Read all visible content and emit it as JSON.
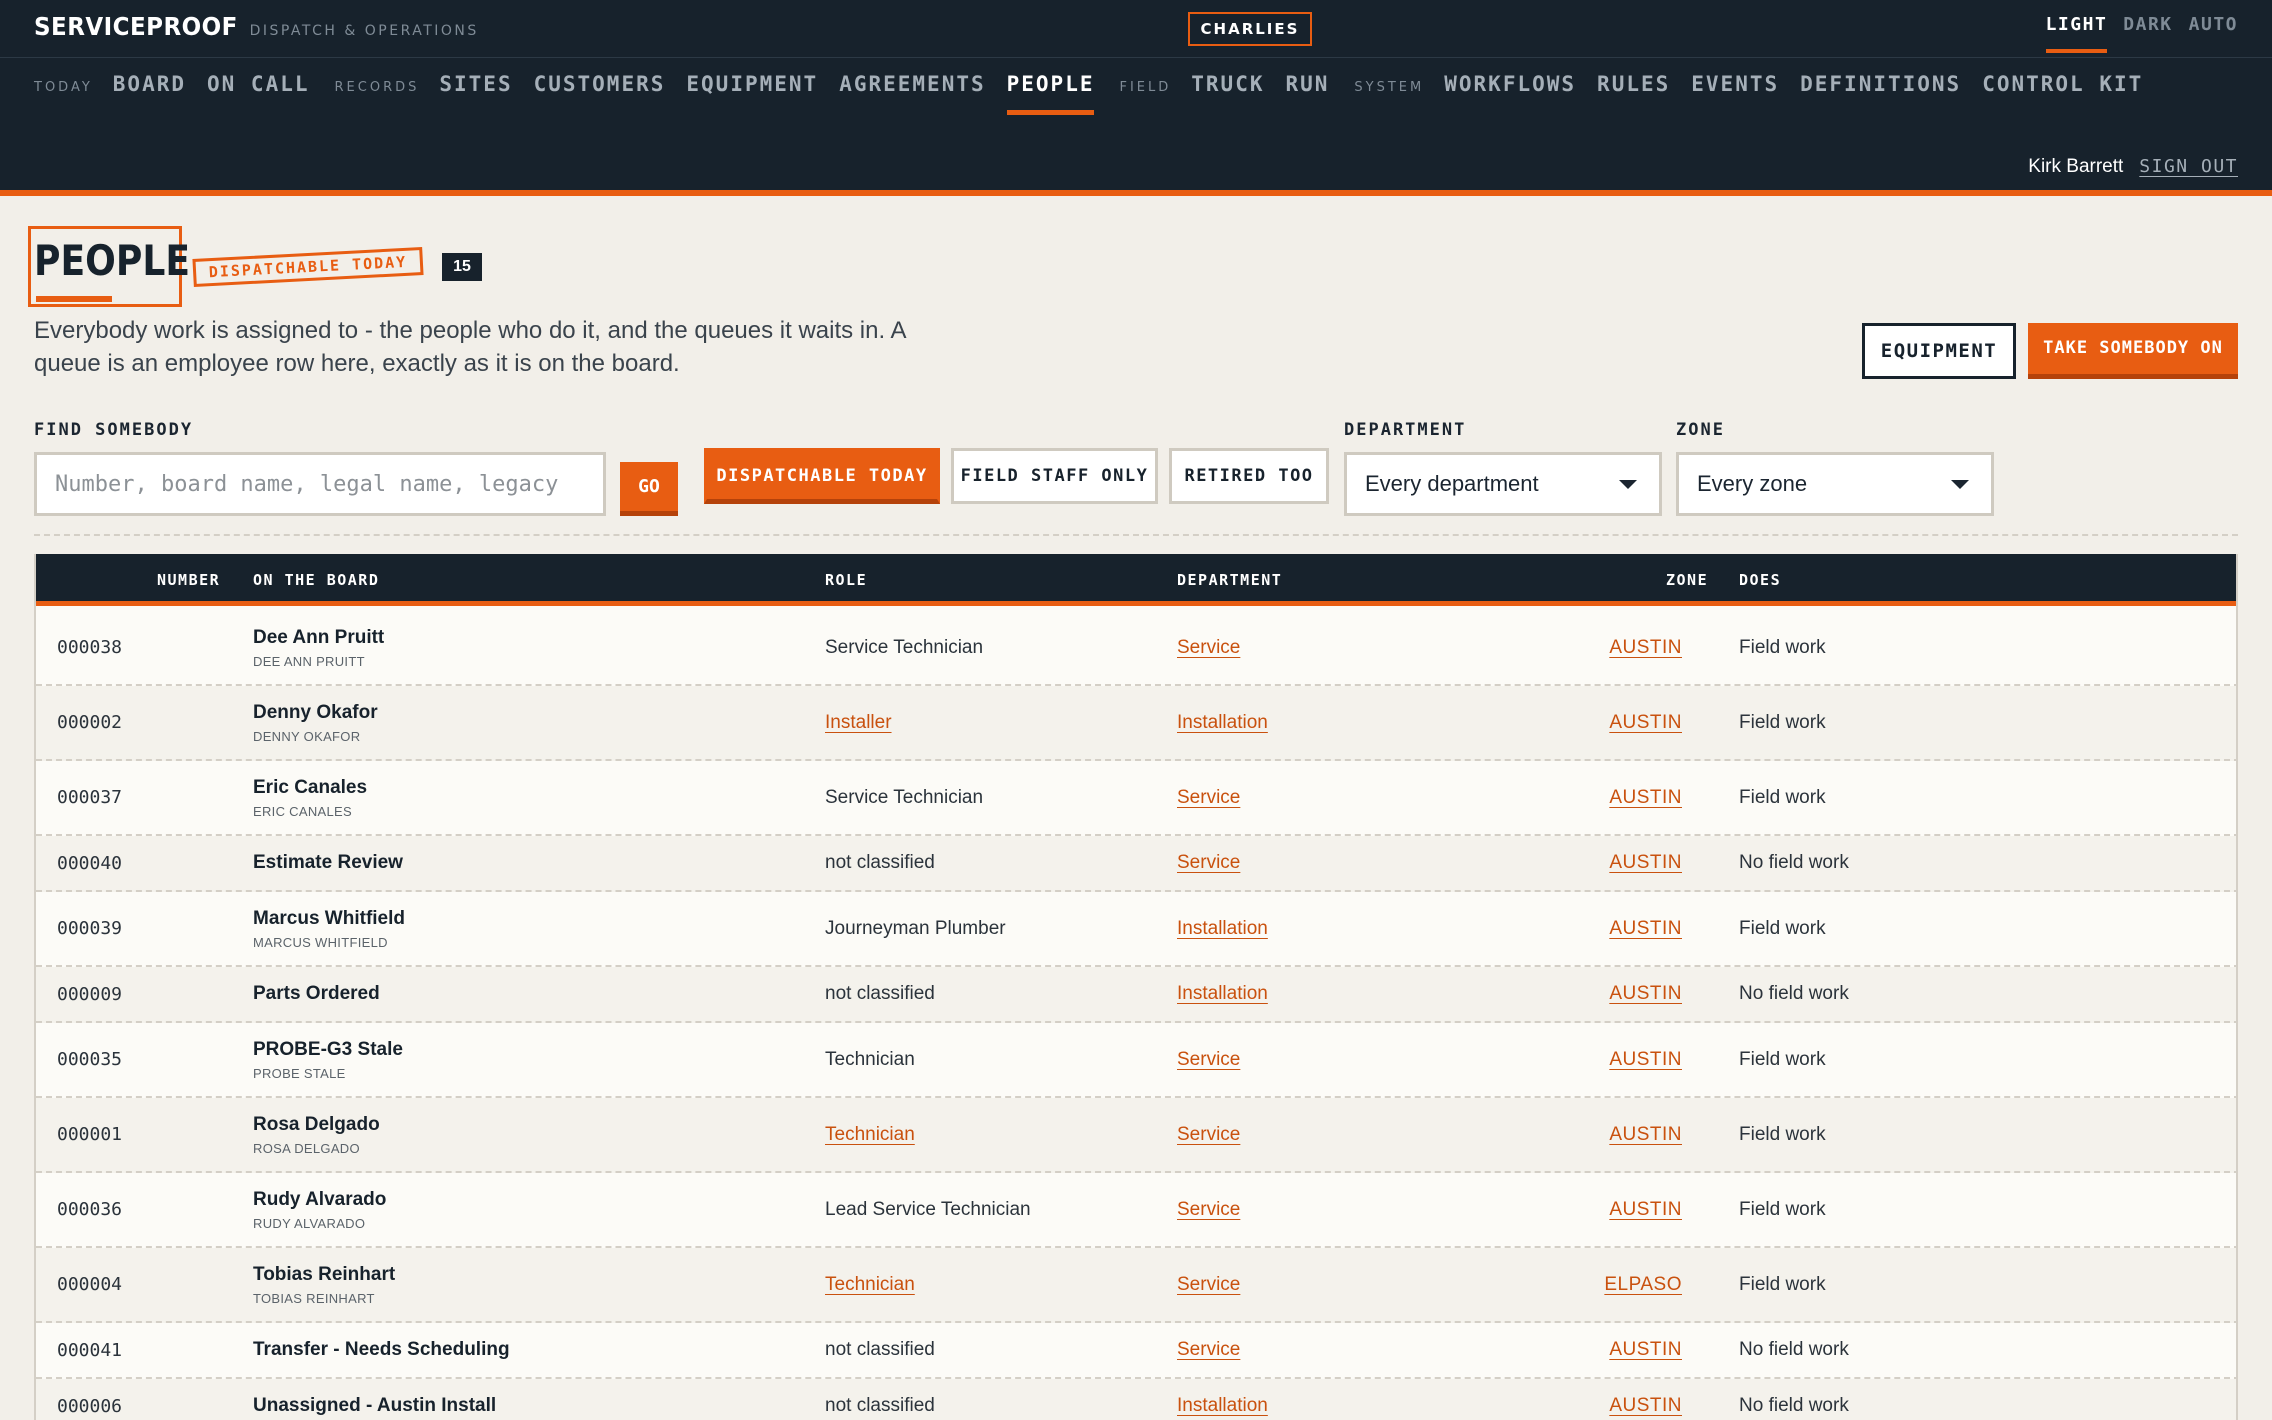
{
  "brand": {
    "name": "SERVICEPROOF",
    "subtitle": "DISPATCH & OPERATIONS"
  },
  "tenant": "CHARLIES",
  "theme": [
    "LIGHT",
    "DARK",
    "AUTO"
  ],
  "theme_active": "LIGHT",
  "nav": {
    "today_group": "TODAY",
    "board": "BOARD",
    "on_call": "ON CALL",
    "records_group": "RECORDS",
    "sites": "SITES",
    "customers": "CUSTOMERS",
    "equipment": "EQUIPMENT",
    "agreements": "AGREEMENTS",
    "people": "PEOPLE",
    "field_group": "FIELD",
    "truck": "TRUCK",
    "run": "RUN",
    "system_group": "SYSTEM",
    "workflows": "WORKFLOWS",
    "rules": "RULES",
    "events": "EVENTS",
    "definitions": "DEFINITIONS",
    "control_kit": "CONTROL KIT"
  },
  "user": {
    "name": "Kirk Barrett",
    "sign_out": "SIGN OUT"
  },
  "page": {
    "title": "PEOPLE",
    "stamp": "DISPATCHABLE TODAY",
    "count": "15",
    "lede": "Everybody work is assigned to - the people who do it, and the queues it waits in. A queue is an employee row here, exactly as it is on the board.",
    "equipment_button": "EQUIPMENT",
    "take_button": "TAKE SOMEBODY ON"
  },
  "filters": {
    "find_label": "FIND SOMEBODY",
    "search_placeholder": "Number, board name, legal name, legacy",
    "go": "GO",
    "chip_dispatchable": "DISPATCHABLE TODAY",
    "chip_field_staff": "FIELD STAFF ONLY",
    "chip_retired": "RETIRED TOO",
    "department_label": "DEPARTMENT",
    "department_value": "Every department",
    "zone_label": "ZONE",
    "zone_value": "Every zone"
  },
  "table": {
    "headers": {
      "number": "NUMBER",
      "on_the_board": "ON THE BOARD",
      "role": "ROLE",
      "department": "DEPARTMENT",
      "zone": "ZONE",
      "does": "DOES"
    },
    "rows": [
      {
        "number": "000038",
        "name": "Dee Ann Pruitt",
        "legal": "DEE ANN PRUITT",
        "role": "Service Technician",
        "role_link": false,
        "department": "Service",
        "zone": "AUSTIN",
        "does": "Field work"
      },
      {
        "number": "000002",
        "name": "Denny Okafor",
        "legal": "DENNY OKAFOR",
        "role": "Installer",
        "role_link": true,
        "department": "Installation",
        "zone": "AUSTIN",
        "does": "Field work"
      },
      {
        "number": "000037",
        "name": "Eric Canales",
        "legal": "ERIC CANALES",
        "role": "Service Technician",
        "role_link": false,
        "department": "Service",
        "zone": "AUSTIN",
        "does": "Field work"
      },
      {
        "number": "000040",
        "name": "Estimate Review",
        "legal": "",
        "role": "not classified",
        "role_link": false,
        "department": "Service",
        "zone": "AUSTIN",
        "does": "No field work"
      },
      {
        "number": "000039",
        "name": "Marcus Whitfield",
        "legal": "MARCUS WHITFIELD",
        "role": "Journeyman Plumber",
        "role_link": false,
        "department": "Installation",
        "zone": "AUSTIN",
        "does": "Field work"
      },
      {
        "number": "000009",
        "name": "Parts Ordered",
        "legal": "",
        "role": "not classified",
        "role_link": false,
        "department": "Installation",
        "zone": "AUSTIN",
        "does": "No field work"
      },
      {
        "number": "000035",
        "name": "PROBE-G3 Stale",
        "legal": "PROBE STALE",
        "role": "Technician",
        "role_link": false,
        "department": "Service",
        "zone": "AUSTIN",
        "does": "Field work"
      },
      {
        "number": "000001",
        "name": "Rosa Delgado",
        "legal": "ROSA DELGADO",
        "role": "Technician",
        "role_link": true,
        "department": "Service",
        "zone": "AUSTIN",
        "does": "Field work"
      },
      {
        "number": "000036",
        "name": "Rudy Alvarado",
        "legal": "RUDY ALVARADO",
        "role": "Lead Service Technician",
        "role_link": false,
        "department": "Service",
        "zone": "AUSTIN",
        "does": "Field work"
      },
      {
        "number": "000004",
        "name": "Tobias Reinhart",
        "legal": "TOBIAS REINHART",
        "role": "Technician",
        "role_link": true,
        "department": "Service",
        "zone": "ELPASO",
        "does": "Field work"
      },
      {
        "number": "000041",
        "name": "Transfer - Needs Scheduling",
        "legal": "",
        "role": "not classified",
        "role_link": false,
        "department": "Service",
        "zone": "AUSTIN",
        "does": "No field work"
      },
      {
        "number": "000006",
        "name": "Unassigned - Austin Install",
        "legal": "",
        "role": "not classified",
        "role_link": false,
        "department": "Installation",
        "zone": "AUSTIN",
        "does": "No field work"
      }
    ]
  },
  "colors": {
    "accent": "#e85d12",
    "nav_bg": "#17222c",
    "page_bg": "#f2efe9",
    "link": "#c9510e"
  }
}
